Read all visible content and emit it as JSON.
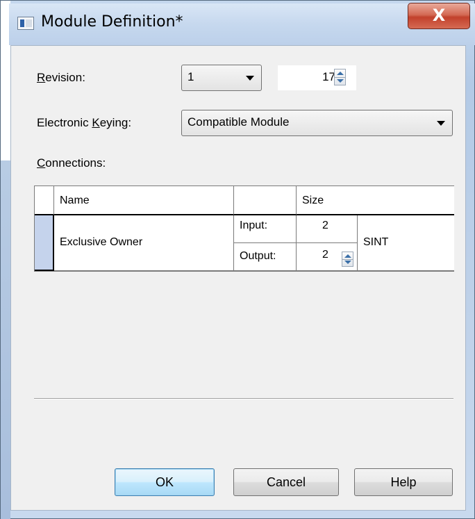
{
  "window": {
    "title": "Module Definition*",
    "close_glyph": "X"
  },
  "revision": {
    "label": "Revision:",
    "label_accelerator": "R",
    "major_value": "1",
    "minor_value": "17"
  },
  "electronic_keying": {
    "label": "Electronic Keying:",
    "label_accelerator": "K",
    "value": "Compatible Module"
  },
  "connections": {
    "label": "Connections:",
    "label_accelerator": "C",
    "columns": [
      "Name",
      "",
      "Size"
    ],
    "rows": [
      {
        "name": "Exclusive Owner",
        "input_label": "Input:",
        "input_size": "2",
        "output_label": "Output:",
        "output_size": "2",
        "data_type": "SINT"
      }
    ]
  },
  "buttons": {
    "ok": "OK",
    "cancel": "Cancel",
    "help": "Help"
  },
  "icons": {
    "app": "module-icon",
    "dropdown": "chevron-down-icon",
    "spinner": "spinner-icon",
    "close": "close-icon"
  },
  "colors": {
    "close_button": "#c2412c",
    "dialog_face": "#f0f0f0",
    "row_indicator": "#c5d3ec",
    "default_button_border": "#3c7fb1"
  }
}
